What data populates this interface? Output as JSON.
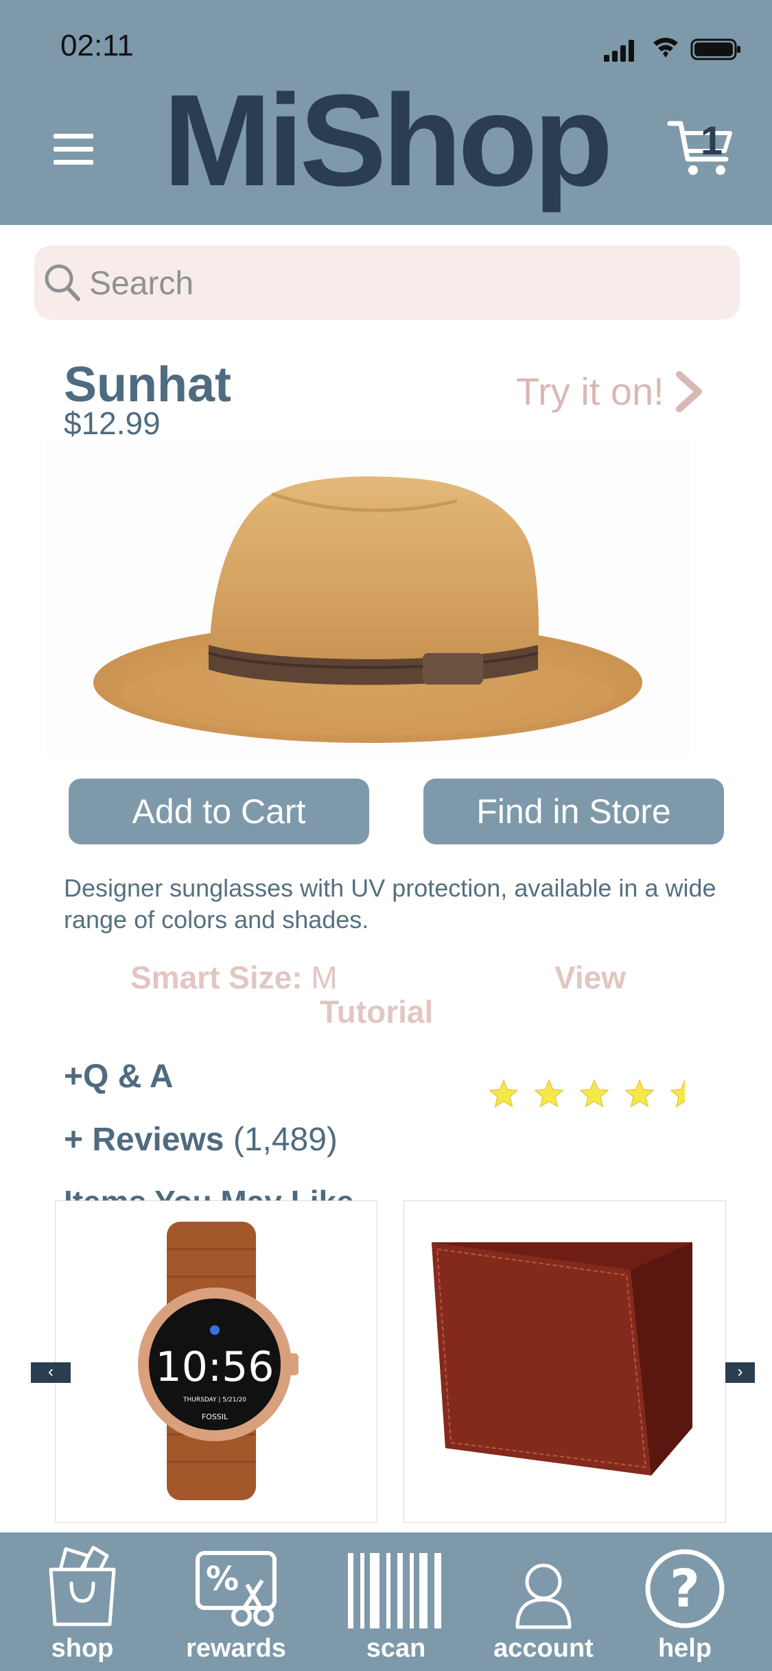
{
  "status_bar": {
    "time": "02:11"
  },
  "header": {
    "brand": "MiShop",
    "cart_count": "1"
  },
  "search": {
    "placeholder": "Search"
  },
  "product": {
    "name": "Sunhat",
    "price": "$12.99",
    "try_on": "Try it on!",
    "add_to_cart": "Add to Cart",
    "find_in_store": "Find in Store",
    "description": "Designer sunglasses with UV protection, available in a wide range of colors and shades.",
    "smart_size_label": "Smart Size:",
    "smart_size_value": "M",
    "view_label": "View",
    "tutorial_label": "Tutorial",
    "qa_label": "+Q & A",
    "reviews_label": "+ Reviews",
    "reviews_count": "(1,489)",
    "rating": 4.5,
    "rating_max": 5
  },
  "recommendations": {
    "title": "Items You May Like",
    "items": [
      {
        "name": "watch",
        "watch_time": "10:56",
        "watch_date": "THURSDAY | 5/21/20",
        "watch_brand": "FOSSIL"
      },
      {
        "name": "wallet"
      }
    ],
    "prev": "‹",
    "next": "›"
  },
  "tabbar": {
    "items": [
      {
        "label": "shop",
        "icon": "shopping-bag-icon"
      },
      {
        "label": "rewards",
        "icon": "coupon-icon"
      },
      {
        "label": "scan",
        "icon": "barcode-icon"
      },
      {
        "label": "account",
        "icon": "user-icon"
      },
      {
        "label": "help",
        "icon": "help-icon"
      }
    ]
  },
  "colors": {
    "header_bg": "#7e99aa",
    "brand": "#2b3d51",
    "accent_text": "#4f6b80",
    "soft_pink": "#e2c6c1",
    "search_bg": "#f7ecea",
    "star": "#f5e94a"
  }
}
